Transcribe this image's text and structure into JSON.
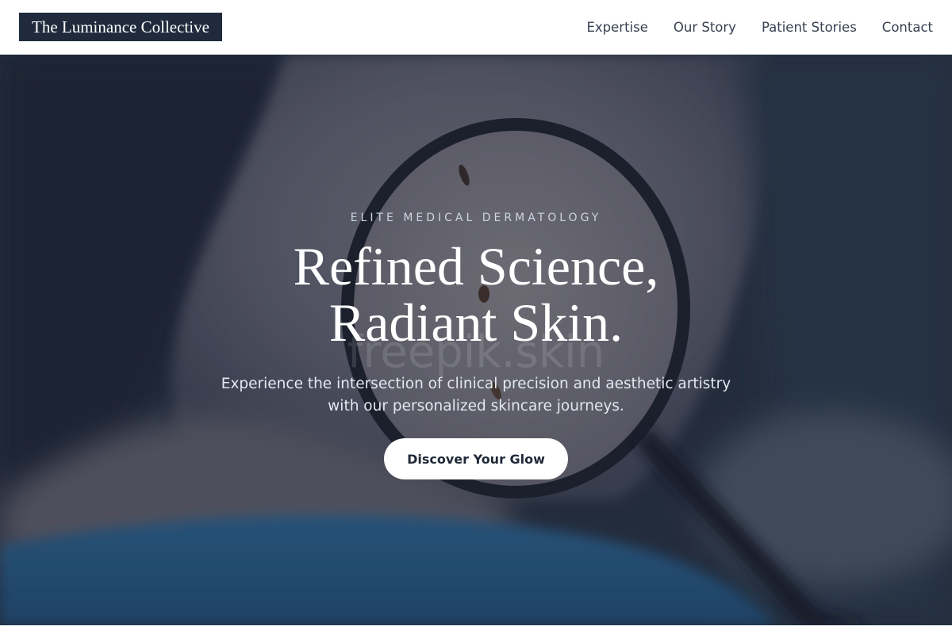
{
  "header": {
    "logo_text": "The Luminance Collective",
    "nav": [
      {
        "label": "Expertise"
      },
      {
        "label": "Our Story"
      },
      {
        "label": "Patient Stories"
      },
      {
        "label": "Contact"
      }
    ]
  },
  "hero": {
    "eyebrow": "ELITE MEDICAL DERMATOLOGY",
    "headline_line1": "Refined Science,",
    "headline_line2": "Radiant Skin.",
    "watermark": "freepik.skin",
    "subtext": "Experience the intersection of clinical precision and aesthetic artistry with our personalized skincare journeys.",
    "cta_label": "Discover Your Glow"
  },
  "colors": {
    "logo_bg": "#1f2a3c",
    "hero_overlay": "#1e2636",
    "shirt_blue": "#2f6d9e",
    "cta_bg": "#ffffff"
  }
}
